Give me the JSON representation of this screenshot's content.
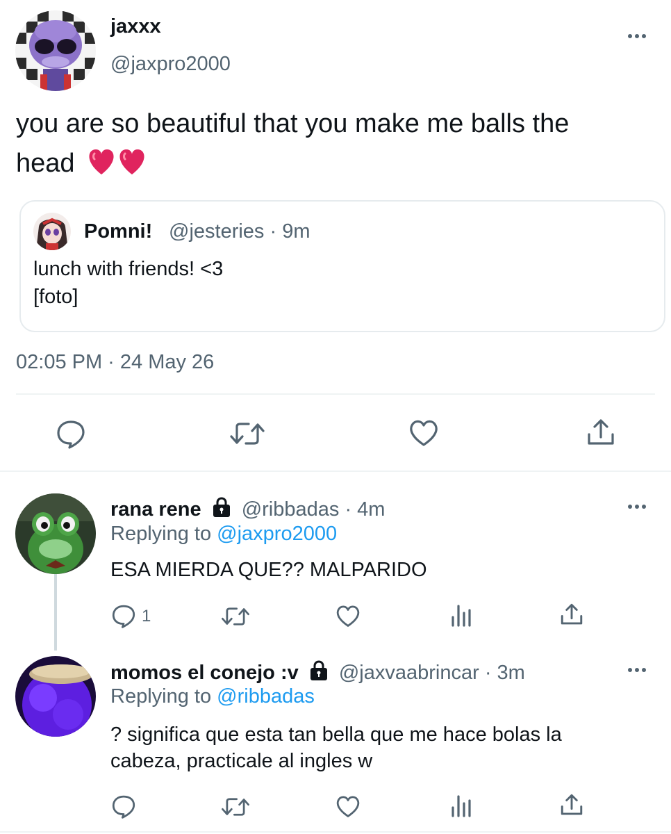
{
  "tweet": {
    "display_name": "jaxxx",
    "handle": "@jaxpro2000",
    "text_line1": "you are so beautiful that you make me balls the",
    "text_line2": "head",
    "emoji": "❤️❤️",
    "timestamp": "02:05 PM · 24 May 26",
    "quoted": {
      "display_name": "Pomni!",
      "handle_time": "@jesteries · 9m",
      "text_line1": "lunch with friends! <3",
      "text_line2": "[foto]"
    },
    "actions": [
      "reply-icon",
      "retweet-icon",
      "like-icon",
      "share-icon"
    ]
  },
  "replies": [
    {
      "display_name": "rana rene",
      "handle_time": "@ribbadas · 4m",
      "replying_prefix": "Replying to",
      "replying_to": "@jaxpro2000",
      "text_line1": "ESA MIERDA QUE?? MALPARIDO",
      "reply_count": "1",
      "protected": true
    },
    {
      "display_name": "momos el conejo :v",
      "handle_time": "@jaxvaabrincar · 3m",
      "replying_prefix": "Replying to",
      "replying_to": "@ribbadas",
      "text_line1": "? significa que esta tan bella que me hace bolas la",
      "text_line2": "cabeza, practicale al ingles w",
      "protected": true
    }
  ],
  "colors": {
    "text": "#0f1419",
    "secondary": "#536471",
    "link": "#1d9bf0",
    "heart": "#e0245e"
  }
}
